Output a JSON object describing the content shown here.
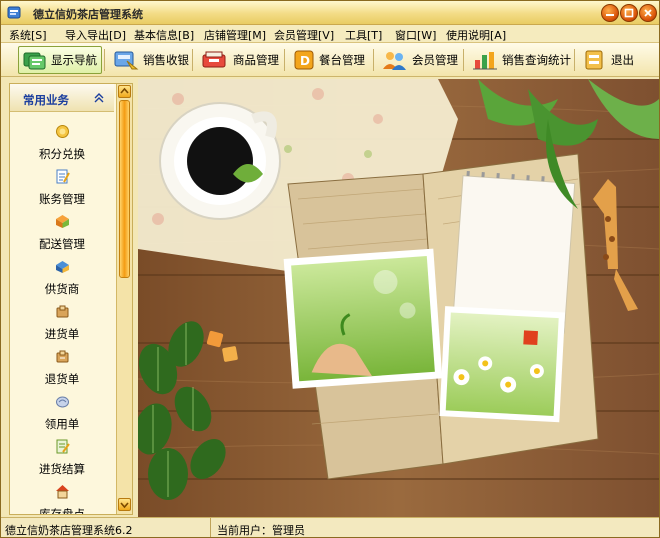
{
  "window": {
    "title": "德立信奶茶店管理系统"
  },
  "menu": [
    "系统[S]",
    "导入导出[D]",
    "基本信息[B]",
    "店铺管理[M]",
    "会员管理[V]",
    "工具[T]",
    "窗口[W]",
    "使用说明[A]"
  ],
  "toolbar": [
    {
      "label": "显示导航",
      "icon": "navigation-icon",
      "active": true
    },
    {
      "label": "销售收银",
      "icon": "cashier-icon"
    },
    {
      "label": "商品管理",
      "icon": "goods-icon"
    },
    {
      "label": "餐台管理",
      "icon": "table-icon"
    },
    {
      "label": "会员管理",
      "icon": "members-icon"
    },
    {
      "label": "销售查询统计",
      "icon": "sales-stats-icon"
    },
    {
      "label": "退出",
      "icon": "exit-icon"
    }
  ],
  "sidebar": {
    "header": "常用业务",
    "items": [
      {
        "label": "积分兑换",
        "icon": "points-icon"
      },
      {
        "label": "账务管理",
        "icon": "accounts-icon"
      },
      {
        "label": "配送管理",
        "icon": "delivery-icon"
      },
      {
        "label": "供货商",
        "icon": "supplier-icon"
      },
      {
        "label": "进货单",
        "icon": "purchase-order-icon"
      },
      {
        "label": "退货单",
        "icon": "return-order-icon"
      },
      {
        "label": "领用单",
        "icon": "requisition-icon"
      },
      {
        "label": "进货结算",
        "icon": "purchase-settle-icon"
      },
      {
        "label": "库存盘点",
        "icon": "inventory-icon"
      }
    ]
  },
  "status": {
    "version": "德立信奶茶店管理系统6.2",
    "user": "当前用户：管理员"
  },
  "colors": {
    "title_bg": "#f3dc86",
    "accent": "#f39b12",
    "sidebar_header": "#1c3f9e",
    "wood": "#8a5a30"
  }
}
